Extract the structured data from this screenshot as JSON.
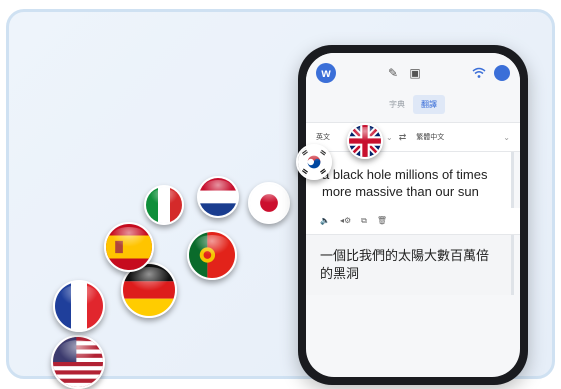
{
  "app": {
    "logo_letter": "w",
    "tabs": [
      {
        "label": "字典",
        "active": false
      },
      {
        "label": "翻譯",
        "active": true
      }
    ],
    "source_lang": "英文",
    "target_lang": "繁體中文",
    "source_text": "a black hole millions of times more massive than our sun",
    "translated_text": "一個比我們的太陽大數百萬倍的黑洞"
  },
  "flags": [
    "korea",
    "uk",
    "japan",
    "netherlands",
    "italy",
    "portugal",
    "spain",
    "germany",
    "france",
    "usa"
  ],
  "colors": {
    "accent": "#3b6fd8",
    "frame": "#cfe1f2",
    "phone": "#1a1b1f"
  }
}
